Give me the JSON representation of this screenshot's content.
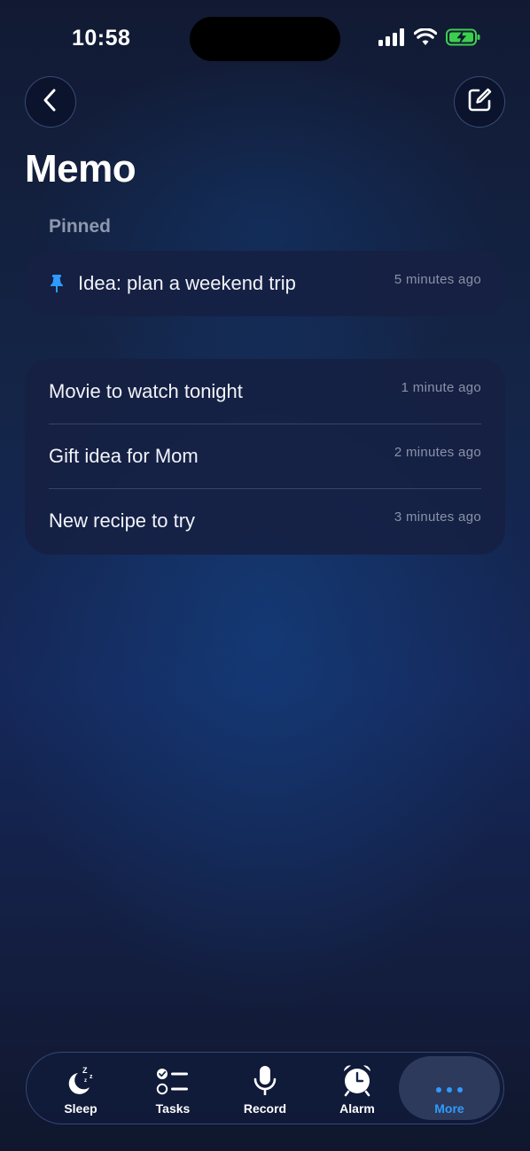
{
  "status_bar": {
    "time": "10:58"
  },
  "header": {
    "title": "Memo"
  },
  "pinned": {
    "section_label": "Pinned",
    "items": [
      {
        "title": "Idea: plan a weekend trip",
        "time": "5 minutes ago"
      }
    ]
  },
  "notes": {
    "items": [
      {
        "title": "Movie to watch tonight",
        "time": "1 minute ago"
      },
      {
        "title": "Gift idea for Mom",
        "time": "2 minutes ago"
      },
      {
        "title": "New recipe to try",
        "time": "3 minutes ago"
      }
    ]
  },
  "tab_bar": {
    "tabs": [
      {
        "label": "Sleep",
        "icon": "moon-zzz-icon"
      },
      {
        "label": "Tasks",
        "icon": "checklist-icon"
      },
      {
        "label": "Record",
        "icon": "microphone-icon"
      },
      {
        "label": "Alarm",
        "icon": "alarm-clock-icon"
      },
      {
        "label": "More",
        "icon": "more-dots-icon",
        "selected": true
      }
    ]
  },
  "colors": {
    "accent": "#2f9bff",
    "battery": "#3ccf4e"
  }
}
